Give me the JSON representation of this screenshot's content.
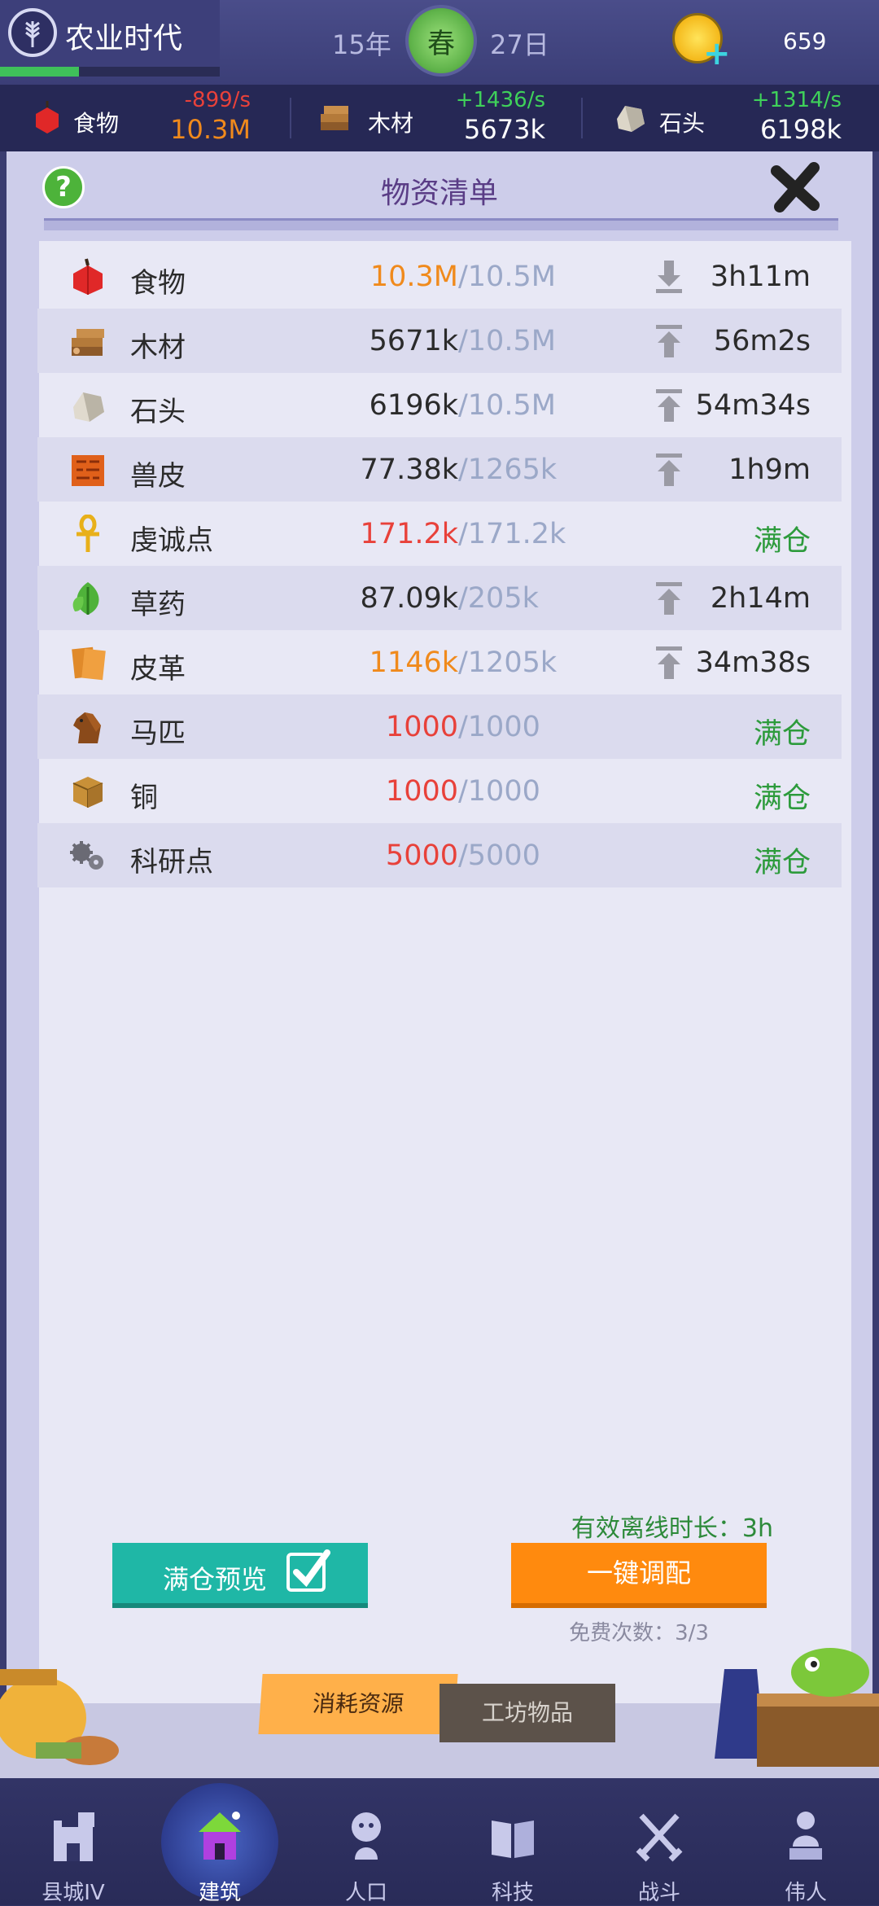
{
  "colors": {
    "accent_green": "#2d9b3c",
    "orange": "#f08a1c",
    "red": "#e8413a",
    "capacity_gray": "#9ba8c8",
    "primary_button_teal": "#1fb7a6",
    "primary_button_orange": "#ff8a0e"
  },
  "header": {
    "era_name": "农业时代",
    "era_progress": 0.36,
    "year": "15年",
    "season": "春",
    "day": "27日",
    "coins": "659"
  },
  "resource_bar": [
    {
      "icon": "apple-icon",
      "name": "食物",
      "rate": "-899/s",
      "amount": "10.3M",
      "rate_color": "#e8413a",
      "amount_color": "#f08a1c"
    },
    {
      "icon": "wood-icon",
      "name": "木材",
      "rate": "+1436/s",
      "amount": "5673k",
      "rate_color": "#3fd15a",
      "amount_color": "#ffffff"
    },
    {
      "icon": "stone-icon",
      "name": "石头",
      "rate": "+1314/s",
      "amount": "6198k",
      "rate_color": "#3fd15a",
      "amount_color": "#ffffff"
    }
  ],
  "panel": {
    "title": "物资清单",
    "help_label": "?",
    "rows": [
      {
        "icon": "apple-icon",
        "name": "食物",
        "current": "10.3M",
        "capacity": "/10.5M",
        "current_color": "#f08a1c",
        "trend": "down",
        "time": "3h11m",
        "full": ""
      },
      {
        "icon": "wood-icon",
        "name": "木材",
        "current": "5671k",
        "capacity": "/10.5M",
        "current_color": "#2b2b2b",
        "trend": "up",
        "time": "56m2s",
        "full": ""
      },
      {
        "icon": "stone-icon",
        "name": "石头",
        "current": "6196k",
        "capacity": "/10.5M",
        "current_color": "#2b2b2b",
        "trend": "up",
        "time": "54m34s",
        "full": ""
      },
      {
        "icon": "hide-icon",
        "name": "兽皮",
        "current": "77.38k",
        "capacity": "/1265k",
        "current_color": "#2b2b2b",
        "trend": "up",
        "time": "1h9m",
        "full": ""
      },
      {
        "icon": "ankh-icon",
        "name": "虔诚点",
        "current": "171.2k",
        "capacity": "/171.2k",
        "current_color": "#e8413a",
        "trend": "none",
        "time": "",
        "full": "满仓"
      },
      {
        "icon": "herb-icon",
        "name": "草药",
        "current": "87.09k",
        "capacity": "/205k",
        "current_color": "#2b2b2b",
        "trend": "up",
        "time": "2h14m",
        "full": ""
      },
      {
        "icon": "leather-icon",
        "name": "皮革",
        "current": "1146k",
        "capacity": "/1205k",
        "current_color": "#f08a1c",
        "trend": "up",
        "time": "34m38s",
        "full": ""
      },
      {
        "icon": "horse-icon",
        "name": "马匹",
        "current": "1000",
        "capacity": "/1000",
        "current_color": "#e8413a",
        "trend": "none",
        "time": "",
        "full": "满仓"
      },
      {
        "icon": "copper-icon",
        "name": "铜",
        "current": "1000",
        "capacity": "/1000",
        "current_color": "#e8413a",
        "trend": "none",
        "time": "",
        "full": "满仓"
      },
      {
        "icon": "gears-icon",
        "name": "科研点",
        "current": "5000",
        "capacity": "/5000",
        "current_color": "#e8413a",
        "trend": "none",
        "time": "",
        "full": "满仓"
      }
    ],
    "offline_text": "有效离线时长：3h",
    "preview_button": "满仓预览",
    "allocate_button": "一键调配",
    "free_count": "免费次数：3/3"
  },
  "sub_tabs": {
    "consumables": "消耗资源",
    "workshop": "工坊物品"
  },
  "bottom_nav": [
    {
      "icon": "town-icon",
      "label": "县城IV",
      "active": false
    },
    {
      "icon": "house-icon",
      "label": "建筑",
      "active": true
    },
    {
      "icon": "person-icon",
      "label": "人口",
      "active": false
    },
    {
      "icon": "book-icon",
      "label": "科技",
      "active": false
    },
    {
      "icon": "swords-icon",
      "label": "战斗",
      "active": false
    },
    {
      "icon": "statue-icon",
      "label": "伟人",
      "active": false
    }
  ]
}
